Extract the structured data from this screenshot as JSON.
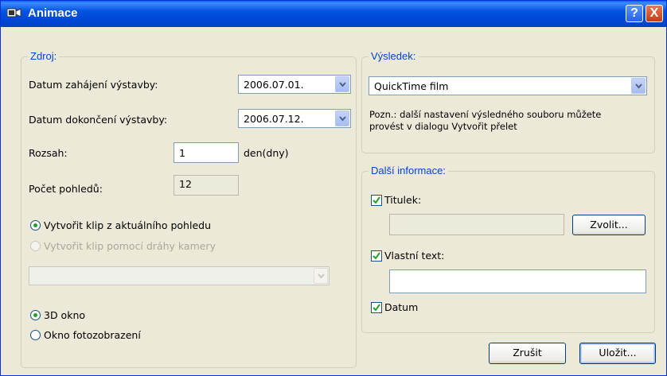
{
  "window": {
    "title": "Animace",
    "help_label": "?",
    "close_label": "X"
  },
  "source": {
    "legend": "Zdroj:",
    "start_date_label": "Datum zahájení výstavby:",
    "start_date_value": "2006.07.01.",
    "end_date_label": "Datum dokončení výstavby:",
    "end_date_value": "2006.07.12.",
    "range_label": "Rozsah:",
    "range_value": "1",
    "range_unit": "den(dny)",
    "views_label": "Počet pohledů:",
    "views_value": "12",
    "radio_current_view": "Vytvořit klip z aktuálního pohledu",
    "radio_camera_path": "Vytvořit klip pomocí dráhy kamery",
    "camera_path_value": "",
    "radio_3d": "3D okno",
    "radio_photo": "Okno fotozobrazení"
  },
  "result": {
    "legend": "Výsledek:",
    "format_value": "QuickTime film",
    "note": "Pozn.: další nastavení výsledného souboru můžete provést v dialogu Vytvořit přelet"
  },
  "extra": {
    "legend": "Další informace:",
    "title_label": "Titulek:",
    "title_value": "",
    "choose_button": "Zvolit...",
    "custom_text_label": "Vlastní text:",
    "custom_text_value": "",
    "date_label": "Datum"
  },
  "buttons": {
    "cancel": "Zrušit",
    "save": "Uložit..."
  },
  "colors": {
    "title_bar": "#0054e3",
    "group_legend": "#0046d5",
    "dialog_bg": "#ece9d8"
  }
}
